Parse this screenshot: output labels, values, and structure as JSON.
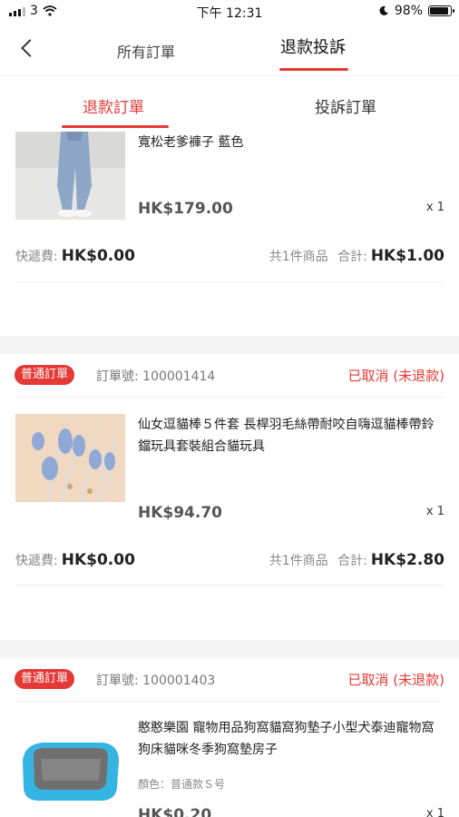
{
  "statusbar": {
    "carrier": "3",
    "time": "下午 12:31",
    "battery_pct": "98%"
  },
  "topnav": {
    "tab_all_orders": "所有訂單",
    "tab_refund_complaint": "退款投訴"
  },
  "subtabs": {
    "refund_orders": "退款訂單",
    "complaint_orders": "投訴訂單"
  },
  "labels": {
    "shipping": "快遞費:",
    "summary": "合計:",
    "order_no": "訂單號:"
  },
  "orders": [
    {
      "title": "寬松老爹褲子 藍色",
      "price": "HK$179.00",
      "qty": "x 1",
      "shipping": "HK$0.00",
      "items_count": "共1件商品",
      "total": "HK$1.00"
    },
    {
      "badge": "普通訂單",
      "order_no": "100001414",
      "status": "已取消 (未退款)",
      "title": "仙女逗貓棒５件套 長桿羽毛絲帶耐咬自嗨逗貓棒帶鈴鐺玩具套裝組合貓玩具",
      "price": "HK$94.70",
      "qty": "x 1",
      "shipping": "HK$0.00",
      "items_count": "共1件商品",
      "total": "HK$2.80"
    },
    {
      "badge": "普通訂單",
      "order_no": "100001403",
      "status": "已取消 (未退款)",
      "title": "憨憨樂園 寵物用品狗窩貓窩狗墊子小型犬泰迪寵物窩狗床貓咪冬季狗窩墊房子",
      "attr": "顏色：普通款Ｓ号",
      "price": "HK$0.20",
      "qty": "x 1"
    }
  ],
  "colors": {
    "accent": "#e53935",
    "gap": "#f4f4f4"
  }
}
